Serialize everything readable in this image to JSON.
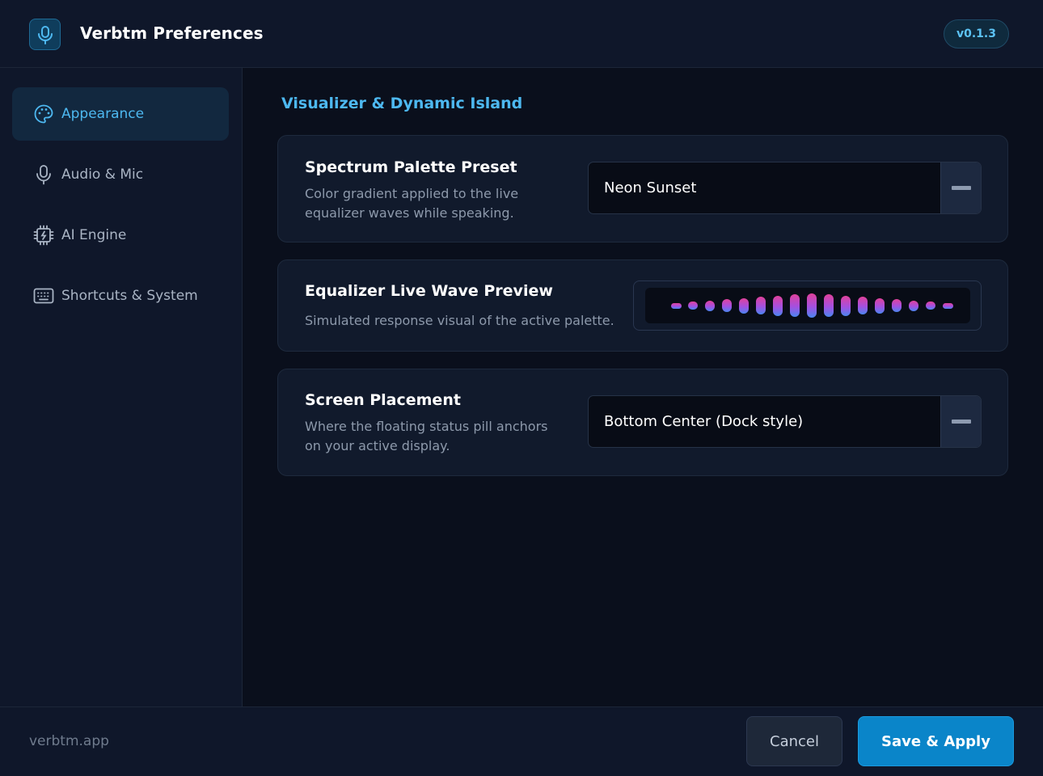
{
  "header": {
    "title": "Verbtm Preferences",
    "version": "v0.1.3",
    "logo_icon": "microphone-icon"
  },
  "sidebar": {
    "items": [
      {
        "label": "Appearance",
        "icon": "palette-icon",
        "active": true
      },
      {
        "label": "Audio & Mic",
        "icon": "microphone-icon",
        "active": false
      },
      {
        "label": "AI Engine",
        "icon": "cpu-chip-icon",
        "active": false
      },
      {
        "label": "Shortcuts & System",
        "icon": "keyboard-icon",
        "active": false
      }
    ]
  },
  "main": {
    "section_title": "Visualizer & Dynamic Island",
    "cards": {
      "palette": {
        "title": "Spectrum Palette Preset",
        "desc_line1": "Color gradient applied to the live",
        "desc_line2": "equalizer waves while speaking.",
        "value": "Neon Sunset"
      },
      "preview": {
        "title": "Equalizer Live Wave Preview",
        "desc": "Simulated response visual of the active palette.",
        "bar_levels": [
          0.25,
          0.35,
          0.45,
          0.55,
          0.65,
          0.75,
          0.85,
          0.95,
          1.0,
          0.95,
          0.85,
          0.75,
          0.65,
          0.55,
          0.45,
          0.35,
          0.25
        ]
      },
      "placement": {
        "title": "Screen Placement",
        "desc_line1": "Where the floating status pill anchors",
        "desc_line2": "on your active display.",
        "value": "Bottom Center (Dock style)"
      }
    }
  },
  "footer": {
    "link": "verbtm.app",
    "cancel_label": "Cancel",
    "save_label": "Save & Apply"
  },
  "colors": {
    "accent": "#4db8f0",
    "primary_button": "#0a85c9",
    "wave_top": "#e0419b",
    "wave_bottom": "#4a86f0"
  }
}
